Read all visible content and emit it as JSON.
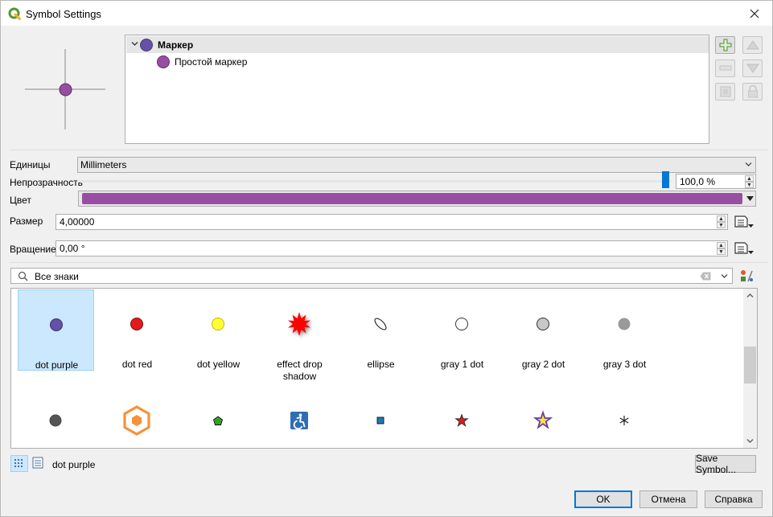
{
  "window": {
    "title": "Symbol Settings"
  },
  "layers": [
    {
      "label": "Маркер",
      "color": "#6651a8",
      "expanded": true
    },
    {
      "label": "Простой маркер",
      "color": "#984ea3"
    }
  ],
  "settings": {
    "units_label": "Единицы",
    "units_value": "Millimeters",
    "opacity_label": "Непрозрачность",
    "opacity_value": "100,0 %",
    "opacity_fraction": 1.0,
    "color_label": "Цвет",
    "color_value": "#984ea3",
    "size_label": "Размер",
    "size_value": "4,00000",
    "rotation_label": "Вращение",
    "rotation_value": "0,00 °"
  },
  "search": {
    "value": "Все знаки"
  },
  "symbols": [
    {
      "name": "dot purple",
      "icon": "dot-purple-icon",
      "selected": true
    },
    {
      "name": "dot red",
      "icon": "dot-red-icon"
    },
    {
      "name": "dot yellow",
      "icon": "dot-yellow-icon"
    },
    {
      "name": "effect drop shadow",
      "icon": "red-starburst-icon"
    },
    {
      "name": "ellipse",
      "icon": "ellipse-icon"
    },
    {
      "name": "gray 1 dot",
      "icon": "gray-1-dot-icon"
    },
    {
      "name": "gray 2 dot",
      "icon": "gray-2-dot-icon"
    },
    {
      "name": "gray 3 dot",
      "icon": "gray-3-dot-icon"
    },
    {
      "name": "",
      "icon": "dark-gray-dot-icon"
    },
    {
      "name": "",
      "icon": "orange-hexagon-icon"
    },
    {
      "name": "",
      "icon": "green-pentagon-icon"
    },
    {
      "name": "",
      "icon": "accessibility-icon"
    },
    {
      "name": "",
      "icon": "blue-square-icon"
    },
    {
      "name": "",
      "icon": "red-star-icon"
    },
    {
      "name": "",
      "icon": "purple-star-icon"
    },
    {
      "name": "",
      "icon": "asterisk-icon"
    }
  ],
  "footer": {
    "selected_symbol": "dot purple",
    "save_symbol": "Save Symbol...",
    "ok": "OK",
    "cancel": "Отмена",
    "help": "Справка"
  }
}
